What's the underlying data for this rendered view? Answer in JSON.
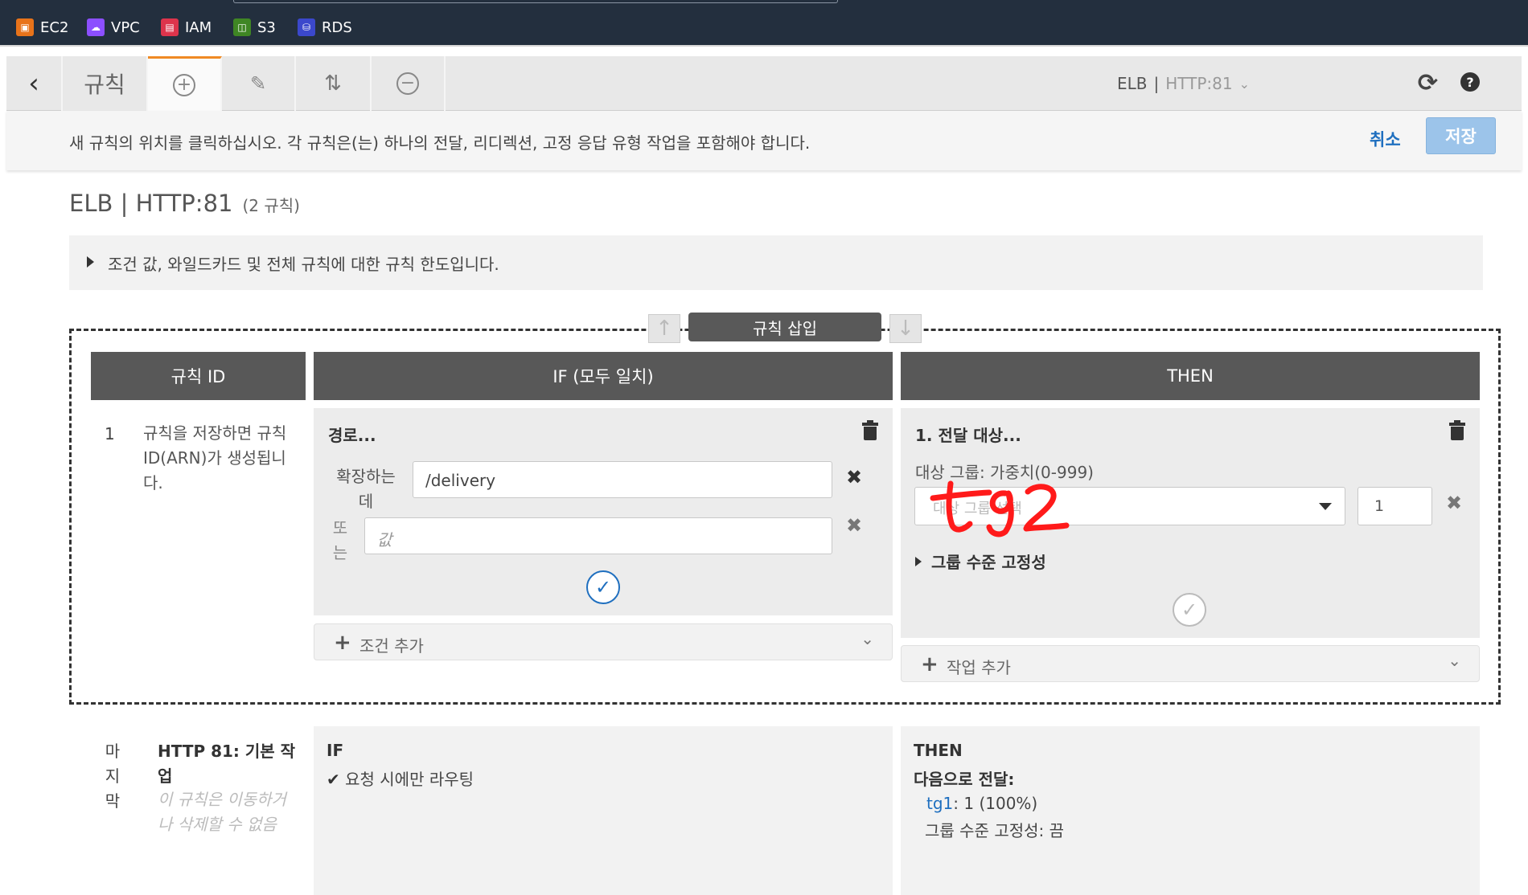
{
  "favorites": [
    {
      "label": "EC2",
      "icon": "ec2-icon",
      "color": "#e8731a"
    },
    {
      "label": "VPC",
      "icon": "vpc-icon",
      "color": "#8c4fff"
    },
    {
      "label": "IAM",
      "icon": "iam-icon",
      "color": "#dd344c"
    },
    {
      "label": "S3",
      "icon": "s3-icon",
      "color": "#3f8624"
    },
    {
      "label": "RDS",
      "icon": "rds-icon",
      "color": "#3b48cc"
    }
  ],
  "toolbar": {
    "title": "규칙",
    "listener_lb": "ELB",
    "listener_port": "HTTP:81"
  },
  "infobar": {
    "message": "새 규칙의 위치를 클릭하십시오. 각 규칙은(는) 하나의 전달, 리디렉션, 고정 응답 유형 작업을 포함해야 합니다.",
    "cancel": "취소",
    "save": "저장"
  },
  "page": {
    "title": "ELB | HTTP:81",
    "rule_count": "(2 규칙)",
    "limits_toggle": "조건 값, 와일드카드 및 전체 규칙에 대한 규칙 한도입니다."
  },
  "insert": {
    "label": "규칙 삽입"
  },
  "columns": {
    "id": "규칙 ID",
    "if": "IF (모두 일치)",
    "then": "THEN"
  },
  "new_rule": {
    "number": "1",
    "id_note": "규칙을 저장하면 규칙 ID(ARN)가 생성됩니다.",
    "if": {
      "title": "경로...",
      "label1": "확장하는데",
      "value1": "/delivery",
      "label2": "또는",
      "placeholder2": "값",
      "add_condition": "조건 추가"
    },
    "then": {
      "title": "1. 전달 대상...",
      "target_label": "대상 그룹: 가중치(0-999)",
      "select_placeholder": "대상 그룹 선택",
      "weight": "1",
      "stickiness": "그룹 수준 고정성",
      "add_action": "작업 추가",
      "annotation": "tg2"
    }
  },
  "last_rule": {
    "id": "마지막",
    "title": "HTTP 81: 기본 작업",
    "note": "이 규칙은 이동하거나 삭제할 수 없음",
    "if_head": "IF",
    "if_text": "요청 시에만 라우팅",
    "then_head": "THEN",
    "then_sub": "다음으로 전달:",
    "tg_name": "tg1",
    "tg_weight": ": 1 (100%)",
    "stickiness": "그룹 수준 고정성: 끔"
  }
}
